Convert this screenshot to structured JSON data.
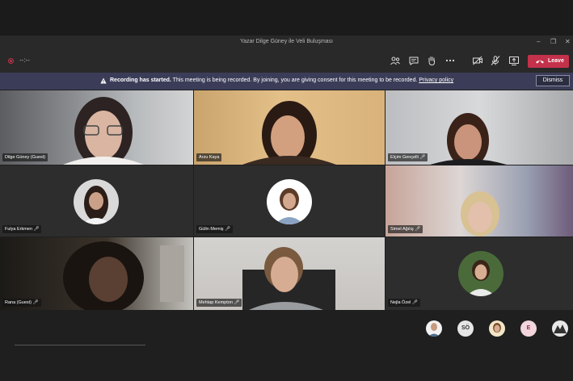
{
  "window": {
    "title": "Yazar Dilge Güney ile Veli Buluşması",
    "minimize": "–",
    "restore": "❐",
    "close": "✕"
  },
  "toolbar": {
    "timer": "--:--",
    "leave_label": "Leave"
  },
  "banner": {
    "bold": "Recording has started.",
    "text": " This meeting is being recorded. By joining, you are giving consent for this meeting to be recorded.",
    "link": "Privacy policy",
    "dismiss": "Dismiss"
  },
  "participants": [
    {
      "name": "Dilge Güney (Guest)",
      "muted": false
    },
    {
      "name": "Arzu Kaya",
      "muted": false
    },
    {
      "name": "Elçim Gençelli",
      "muted": true
    },
    {
      "name": "Fulya Erkmen",
      "muted": true
    },
    {
      "name": "Gülin Memiş",
      "muted": true
    },
    {
      "name": "Simel Ağılış",
      "muted": true
    },
    {
      "name": "Rana (Guest)",
      "muted": true
    },
    {
      "name": "Mehtap Kempton",
      "muted": true
    },
    {
      "name": "Nejla Özel",
      "muted": true
    }
  ],
  "overflow": {
    "initials": [
      "SÖ",
      "E"
    ]
  },
  "colors": {
    "leave": "#c4314b",
    "banner": "#3b3d58",
    "accent_pink": "#f3d6dc"
  }
}
